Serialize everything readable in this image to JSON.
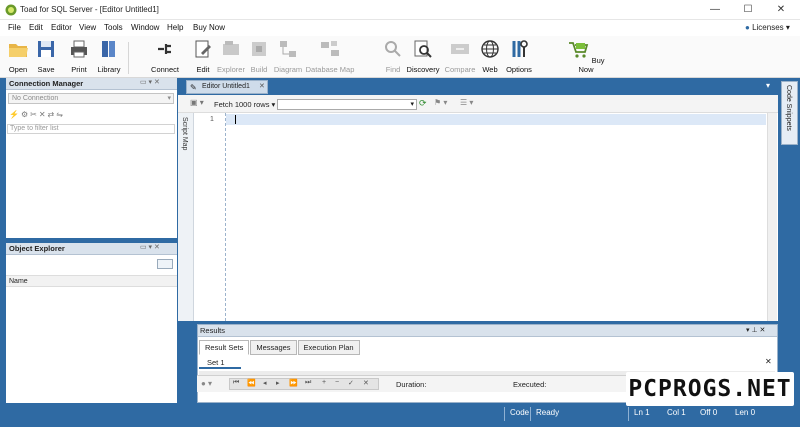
{
  "window": {
    "title": "Toad for SQL Server - [Editor Untitled1]",
    "minimize": "—",
    "maximize": "☐",
    "close": "✕"
  },
  "menu": [
    "File",
    "Edit",
    "Editor",
    "View",
    "Tools",
    "Window",
    "Help",
    "Buy Now"
  ],
  "licenses": "Licenses",
  "toolbar": {
    "open": "Open",
    "save": "Save",
    "print": "Print",
    "library": "Library",
    "connect": "Connect",
    "edit": "Edit",
    "explorer": "Explorer",
    "build": "Build",
    "diagram": "Diagram",
    "database_map": "Database Map",
    "find": "Find",
    "discovery": "Discovery",
    "compare": "Compare",
    "web": "Web",
    "options": "Options",
    "buy_now": "Buy Now"
  },
  "connection_manager": {
    "title": "Connection Manager",
    "select": "No Connection",
    "filter_placeholder": "Type to filter list"
  },
  "object_explorer": {
    "title": "Object Explorer",
    "column": "Name"
  },
  "editor": {
    "tab": "Editor Untitled1",
    "fetch": "Fetch 1000 rows",
    "line_number": "1",
    "script_map": "Script Map"
  },
  "results": {
    "title": "Results",
    "tabs": [
      "Result Sets",
      "Messages",
      "Execution Plan"
    ],
    "set_tab": "Set 1",
    "duration_label": "Duration:",
    "executed_label": "Executed:"
  },
  "code_snippets": "Code Snippets",
  "status": {
    "code": "Code",
    "ready": "Ready",
    "ln": "Ln 1",
    "col": "Col 1",
    "off": "Off 0",
    "len": "Len 0"
  },
  "watermark": "PCPROGS.NET",
  "colors": {
    "frame": "#2f6aa3",
    "panel_title": "#d9e2ec",
    "editor_line": "#dce8f7"
  }
}
